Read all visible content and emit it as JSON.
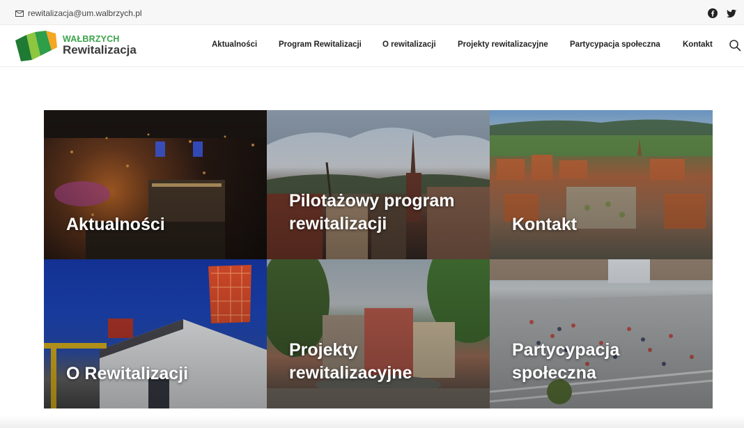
{
  "topbar": {
    "email": "rewitalizacja@um.walbrzych.pl",
    "icons": [
      "mail-icon",
      "facebook-icon",
      "twitter-icon"
    ]
  },
  "logo": {
    "line1": "WAŁBRZYCH",
    "line2": "Rewitalizacja",
    "colors": [
      "#2f8f3a",
      "#8dc63f",
      "#f5a623",
      "#1f6b2c"
    ]
  },
  "nav": {
    "items": [
      {
        "label": "Aktualności"
      },
      {
        "label": "Program Rewitalizacji"
      },
      {
        "label": "O rewitalizacji"
      },
      {
        "label": "Projekty rewitalizacyjne"
      },
      {
        "label": "Partycypacja społeczna"
      },
      {
        "label": "Kontakt"
      }
    ],
    "search_icon": "search-icon"
  },
  "tiles": [
    {
      "line1": "Aktualności",
      "line2": ""
    },
    {
      "line1": "Pilotażowy program",
      "line2": "rewitalizacji"
    },
    {
      "line1": "Kontakt",
      "line2": ""
    },
    {
      "line1": "O Rewitalizacji",
      "line2": ""
    },
    {
      "line1": "Projekty",
      "line2": "rewitalizacyjne"
    },
    {
      "line1": "Partycypacja",
      "line2": "społeczna"
    }
  ]
}
